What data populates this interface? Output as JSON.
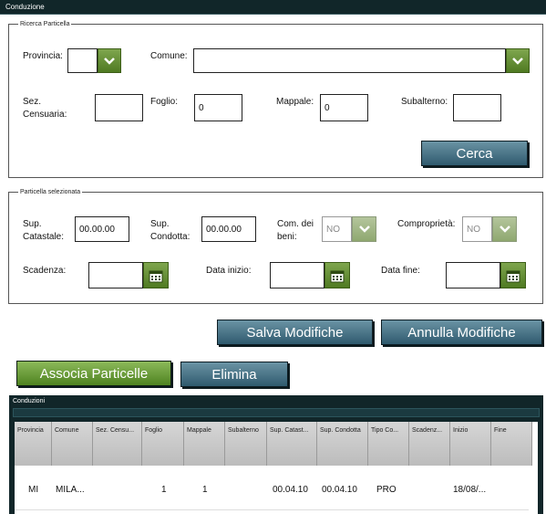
{
  "window": {
    "title": "Conduzione"
  },
  "ricerca": {
    "legend": "Ricerca Particella",
    "provincia_label": "Provincia:",
    "provincia_value": "",
    "comune_label": "Comune:",
    "comune_value": "",
    "sez_label_1": "Sez.",
    "sez_label_2": "Censuaria:",
    "sez_value": "",
    "foglio_label": "Foglio:",
    "foglio_value": "0",
    "mappale_label": "Mappale:",
    "mappale_value": "0",
    "subalterno_label": "Subalterno:",
    "subalterno_value": "",
    "cerca_label": "Cerca"
  },
  "selezionata": {
    "legend": "Particella selezionata",
    "sup_catastale_label_1": "Sup.",
    "sup_catastale_label_2": "Catastale:",
    "sup_catastale_value": "00.00.00",
    "sup_condotta_label_1": "Sup.",
    "sup_condotta_label_2": "Condotta:",
    "sup_condotta_value": "00.00.00",
    "com_beni_label_1": "Com. dei",
    "com_beni_label_2": "beni:",
    "com_beni_value": "NO",
    "comproprieta_label": "Comproprietà:",
    "comproprieta_value": "NO",
    "scadenza_label": "Scadenza:",
    "scadenza_value": "",
    "data_inizio_label": "Data inizio:",
    "data_inizio_value": "",
    "data_fine_label": "Data fine:",
    "data_fine_value": ""
  },
  "actions": {
    "salva_label": "Salva Modifiche",
    "annulla_label": "Annulla Modifiche",
    "associa_label": "Associa Particelle",
    "elimina_label": "Elimina"
  },
  "grid": {
    "title": "Conduzioni",
    "columns": [
      "Provincia",
      "Comune",
      "Sez. Censu...",
      "Foglio",
      "Mappale",
      "Subalterno",
      "Sup. Catast...",
      "Sup. Condotta",
      "Tipo Co...",
      "Scadenz...",
      "Inizio",
      "Fine"
    ],
    "rows": [
      [
        "MI",
        "MILA...",
        "",
        "1",
        "1",
        "",
        "00.04.10",
        "00.04.10",
        "PRO",
        "",
        "18/08/...",
        ""
      ]
    ]
  },
  "colors": {
    "accent_green": "#5a8a2a",
    "button_blue": "#3d6a7e",
    "panel_dark": "#112629"
  }
}
